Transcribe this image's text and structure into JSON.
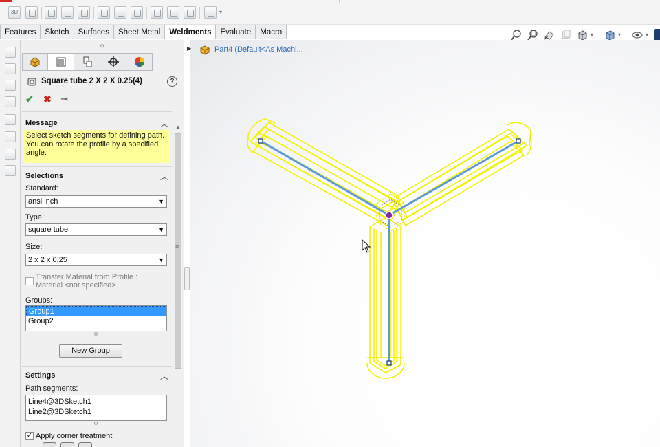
{
  "toolbar": {
    "view_3d_label": "3D"
  },
  "command_tabs": [
    {
      "label": "Features",
      "active": false
    },
    {
      "label": "Sketch",
      "active": false
    },
    {
      "label": "Surfaces",
      "active": false
    },
    {
      "label": "Sheet Metal",
      "active": false
    },
    {
      "label": "Weldments",
      "active": true
    },
    {
      "label": "Evaluate",
      "active": false
    },
    {
      "label": "Macro",
      "active": false
    }
  ],
  "heads_up_toolbar": {
    "icons": [
      "zoom-to-fit-icon",
      "zoom-to-area-icon",
      "previous-view-icon",
      "section-view-icon",
      "view-orientation-icon",
      "display-style-icon",
      "hide-show-items-icon"
    ]
  },
  "property_manager": {
    "tab_icons": [
      "feature-manager-icon",
      "property-manager-icon",
      "configuration-manager-icon",
      "dimxpert-manager-icon",
      "display-manager-icon"
    ],
    "title": "Square tube 2 X 2 X 0.25(4)",
    "help_label": "?",
    "ok_label": "✔",
    "cancel_label": "✖",
    "pin_label": "⇥",
    "message": {
      "title": "Message",
      "text": "Select sketch segments for defining path. You can rotate the profile by a specified angle."
    },
    "selections": {
      "title": "Selections",
      "standard_label": "Standard:",
      "standard_value": "ansi inch",
      "type_label": "Type :",
      "type_value": "square tube",
      "size_label": "Size:",
      "size_value": "2 x 2 x 0.25",
      "transfer_material_line1": "Transfer Material from Profile :",
      "transfer_material_line2": "Material <not specified>",
      "transfer_material_checked": false,
      "groups_label": "Groups:",
      "groups": [
        "Group1",
        "Group2"
      ],
      "selected_group": "Group1",
      "new_group_label": "New Group"
    },
    "settings": {
      "title": "Settings",
      "path_segments_label": "Path segments:",
      "path_segments": [
        "Line4@3DSketch1",
        "Line2@3DSketch1"
      ],
      "corner_treatment_label": "Apply corner treatment",
      "corner_treatment_checked": true
    }
  },
  "feature_tree": {
    "part_label": "Part4  (Default<As Machi..."
  },
  "colors": {
    "weldment_preview": "#f2f200",
    "sketch_path": "#5b9bd5",
    "selected_group_bg": "#3399ff",
    "message_bg": "#ffff99",
    "tree_text": "#2d6db3"
  }
}
